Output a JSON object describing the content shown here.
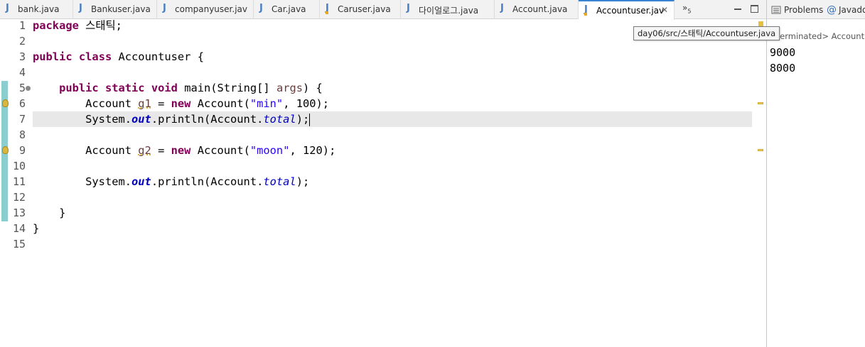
{
  "editor_tabs": [
    {
      "label": "bank.java",
      "active": false
    },
    {
      "label": "Bankuser.java",
      "active": false
    },
    {
      "label": "companyuser.jav",
      "active": false
    },
    {
      "label": "Car.java",
      "active": false
    },
    {
      "label": "Caruser.java",
      "active": false
    },
    {
      "label": "다이얼로그.java",
      "active": false
    },
    {
      "label": "Account.java",
      "active": false
    },
    {
      "label": "Accountuser.jav",
      "active": true
    }
  ],
  "tab_overflow": {
    "symbol": "»",
    "count": "5"
  },
  "tooltip": "day06/src/스태틱/Accountuser.java",
  "code": {
    "lines": [
      "1",
      "2",
      "3",
      "4",
      "5",
      "6",
      "7",
      "8",
      "9",
      "10",
      "11",
      "12",
      "13",
      "14",
      "15"
    ],
    "package_kw": "package",
    "package_name": " 스태틱;",
    "public_kw": "public",
    "class_kw": "class",
    "class_name": " Accountuser {",
    "static_kw": "static",
    "void_kw": "void",
    "main_sig": " main(String[] ",
    "args": "args",
    "main_close": ") {",
    "account_type": "Account ",
    "g1": "g1",
    "assign": " = ",
    "new_kw": "new",
    "ctor": " Account(",
    "min_str": "\"min\"",
    "arg_100": ", 100);",
    "system_out": "System.",
    "out": "out",
    "println": ".println(Account.",
    "total": "total",
    "close_call": ");",
    "g2": "g2",
    "moon_str": "\"moon\"",
    "arg_120": ", 120);",
    "method_close": "}",
    "class_close": "}"
  },
  "right_panel": {
    "problems_label": "Problems",
    "javadoc_label": "Javado",
    "console_status": "<terminated> Accountus",
    "output": [
      "9000",
      "8000"
    ]
  },
  "colors": {
    "keyword": "#7f0055",
    "string": "#2a00ff",
    "field": "#0000c0",
    "change_bar": "#8ccdcf",
    "current_line": "#e8e8e8"
  }
}
